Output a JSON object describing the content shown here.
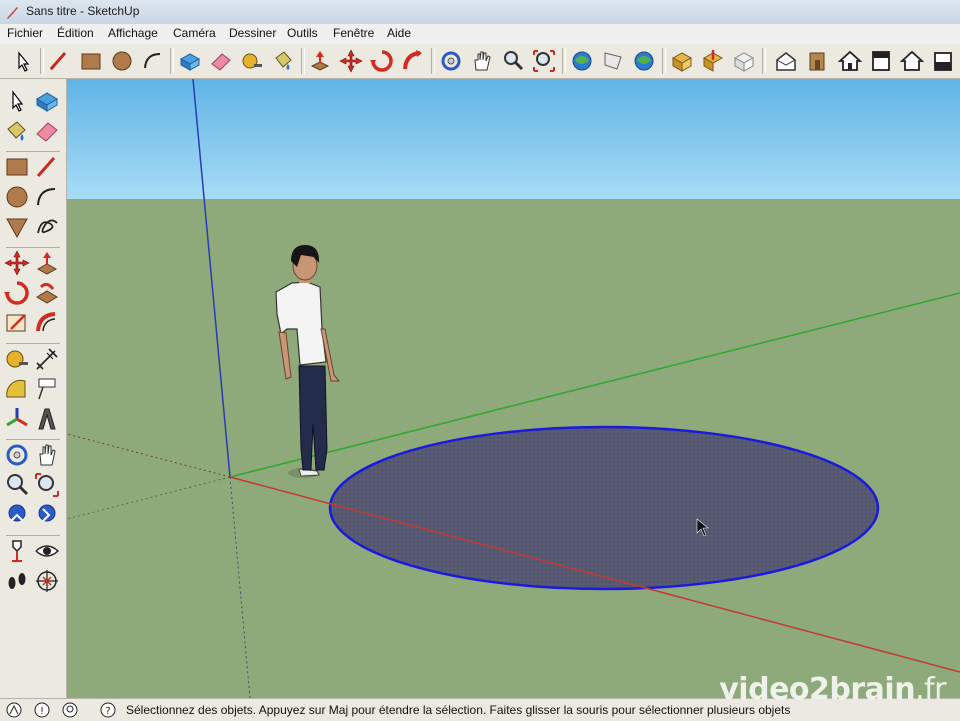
{
  "window": {
    "title": "Sans titre - SketchUp"
  },
  "menu": [
    "Fichier",
    "Édition",
    "Affichage",
    "Caméra",
    "Dessiner",
    "Outils",
    "Fenêtre",
    "Aide"
  ],
  "status": {
    "text": "Sélectionnez des objets. Appuyez sur Maj pour étendre la sélection. Faites glisser la souris pour sélectionner plusieurs objets"
  },
  "watermark": {
    "brand": "video2brain",
    "tld": ".fr"
  },
  "colors": {
    "sky": "#7ec8ee",
    "ground": "#8faa7a",
    "selection_blue": "#1a1adf",
    "circle_fill": "#55566f",
    "axis_red": "#c43a33",
    "axis_green": "#2fa82f",
    "axis_blue": "#2a3bb5"
  },
  "toolbar_icons": [
    "select-icon",
    "line-icon",
    "rectangle-icon",
    "circle-icon",
    "arc-icon",
    "make-component-icon",
    "eraser-icon",
    "tape-measure-icon",
    "paint-bucket-icon",
    "push-pull-icon",
    "move-icon",
    "rotate-icon",
    "follow-me-icon",
    "orbit-icon",
    "pan-icon",
    "zoom-icon",
    "zoom-extents-icon",
    "previous-view-icon",
    "next-view-icon",
    "get-models-icon",
    "share-model-icon",
    "get-components-icon",
    "share-component-icon",
    "extension-icon",
    "iso-view-icon",
    "front-view-icon",
    "top-view-icon",
    "right-view-icon",
    "back-view-icon",
    "left-view-icon"
  ]
}
